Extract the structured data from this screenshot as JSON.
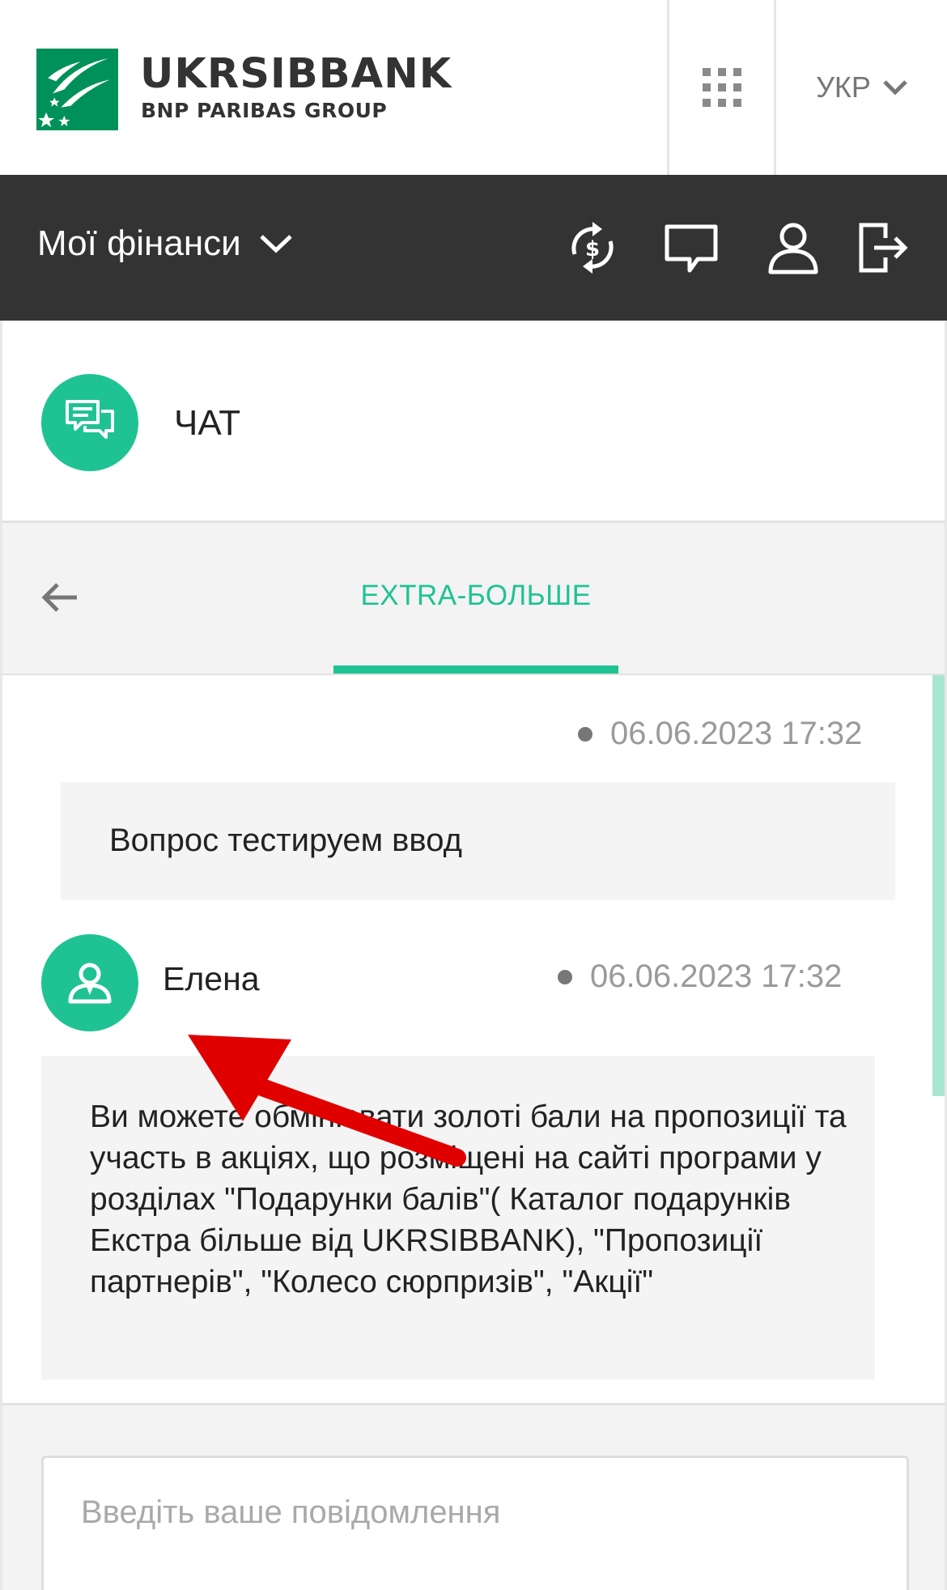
{
  "header": {
    "brand_name": "UKRSIBBANK",
    "brand_sub": "BNP PARIBAS GROUP",
    "language": "УКР",
    "icons": [
      "apps-grid-icon",
      "chevron-down-icon"
    ]
  },
  "nav": {
    "menu_label": "Мої фінанси",
    "icons": [
      "currency-exchange-icon",
      "chat-icon",
      "profile-icon",
      "logout-icon"
    ]
  },
  "chat": {
    "title": "ЧАТ",
    "active_tab": "EXTRA-БОЛЬШЕ"
  },
  "messages": [
    {
      "author": "",
      "time": "06.06.2023 17:32",
      "text": "Вопрос тестируем ввод"
    },
    {
      "author": "Елена",
      "time": "06.06.2023 17:32",
      "text": "Ви можете обмінювати золоті бали на пропозиції та участь в акціях, що розміщені на сайті програми у розділах \"Подарунки балів\"( Каталог подарунків Екстра більше від UKRSIBBANK), \"Пропозиції партнерів\", \"Колесо сюрпризів\", \"Акції\""
    }
  ],
  "composer": {
    "placeholder": "Введіть ваше повідомлення"
  },
  "colors": {
    "accent": "#1fc393",
    "brand_green": "#00915a",
    "nav_bg": "#333333",
    "annotation_arrow": "#e00000"
  }
}
